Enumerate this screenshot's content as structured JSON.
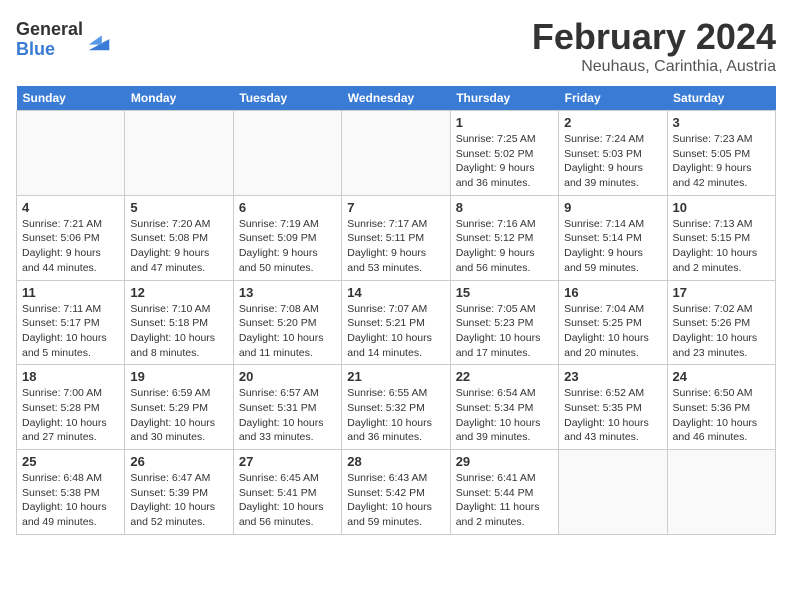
{
  "logo": {
    "general": "General",
    "blue": "Blue"
  },
  "title": {
    "month": "February 2024",
    "location": "Neuhaus, Carinthia, Austria"
  },
  "weekdays": [
    "Sunday",
    "Monday",
    "Tuesday",
    "Wednesday",
    "Thursday",
    "Friday",
    "Saturday"
  ],
  "weeks": [
    [
      {
        "day": "",
        "info": ""
      },
      {
        "day": "",
        "info": ""
      },
      {
        "day": "",
        "info": ""
      },
      {
        "day": "",
        "info": ""
      },
      {
        "day": "1",
        "info": "Sunrise: 7:25 AM\nSunset: 5:02 PM\nDaylight: 9 hours\nand 36 minutes."
      },
      {
        "day": "2",
        "info": "Sunrise: 7:24 AM\nSunset: 5:03 PM\nDaylight: 9 hours\nand 39 minutes."
      },
      {
        "day": "3",
        "info": "Sunrise: 7:23 AM\nSunset: 5:05 PM\nDaylight: 9 hours\nand 42 minutes."
      }
    ],
    [
      {
        "day": "4",
        "info": "Sunrise: 7:21 AM\nSunset: 5:06 PM\nDaylight: 9 hours\nand 44 minutes."
      },
      {
        "day": "5",
        "info": "Sunrise: 7:20 AM\nSunset: 5:08 PM\nDaylight: 9 hours\nand 47 minutes."
      },
      {
        "day": "6",
        "info": "Sunrise: 7:19 AM\nSunset: 5:09 PM\nDaylight: 9 hours\nand 50 minutes."
      },
      {
        "day": "7",
        "info": "Sunrise: 7:17 AM\nSunset: 5:11 PM\nDaylight: 9 hours\nand 53 minutes."
      },
      {
        "day": "8",
        "info": "Sunrise: 7:16 AM\nSunset: 5:12 PM\nDaylight: 9 hours\nand 56 minutes."
      },
      {
        "day": "9",
        "info": "Sunrise: 7:14 AM\nSunset: 5:14 PM\nDaylight: 9 hours\nand 59 minutes."
      },
      {
        "day": "10",
        "info": "Sunrise: 7:13 AM\nSunset: 5:15 PM\nDaylight: 10 hours\nand 2 minutes."
      }
    ],
    [
      {
        "day": "11",
        "info": "Sunrise: 7:11 AM\nSunset: 5:17 PM\nDaylight: 10 hours\nand 5 minutes."
      },
      {
        "day": "12",
        "info": "Sunrise: 7:10 AM\nSunset: 5:18 PM\nDaylight: 10 hours\nand 8 minutes."
      },
      {
        "day": "13",
        "info": "Sunrise: 7:08 AM\nSunset: 5:20 PM\nDaylight: 10 hours\nand 11 minutes."
      },
      {
        "day": "14",
        "info": "Sunrise: 7:07 AM\nSunset: 5:21 PM\nDaylight: 10 hours\nand 14 minutes."
      },
      {
        "day": "15",
        "info": "Sunrise: 7:05 AM\nSunset: 5:23 PM\nDaylight: 10 hours\nand 17 minutes."
      },
      {
        "day": "16",
        "info": "Sunrise: 7:04 AM\nSunset: 5:25 PM\nDaylight: 10 hours\nand 20 minutes."
      },
      {
        "day": "17",
        "info": "Sunrise: 7:02 AM\nSunset: 5:26 PM\nDaylight: 10 hours\nand 23 minutes."
      }
    ],
    [
      {
        "day": "18",
        "info": "Sunrise: 7:00 AM\nSunset: 5:28 PM\nDaylight: 10 hours\nand 27 minutes."
      },
      {
        "day": "19",
        "info": "Sunrise: 6:59 AM\nSunset: 5:29 PM\nDaylight: 10 hours\nand 30 minutes."
      },
      {
        "day": "20",
        "info": "Sunrise: 6:57 AM\nSunset: 5:31 PM\nDaylight: 10 hours\nand 33 minutes."
      },
      {
        "day": "21",
        "info": "Sunrise: 6:55 AM\nSunset: 5:32 PM\nDaylight: 10 hours\nand 36 minutes."
      },
      {
        "day": "22",
        "info": "Sunrise: 6:54 AM\nSunset: 5:34 PM\nDaylight: 10 hours\nand 39 minutes."
      },
      {
        "day": "23",
        "info": "Sunrise: 6:52 AM\nSunset: 5:35 PM\nDaylight: 10 hours\nand 43 minutes."
      },
      {
        "day": "24",
        "info": "Sunrise: 6:50 AM\nSunset: 5:36 PM\nDaylight: 10 hours\nand 46 minutes."
      }
    ],
    [
      {
        "day": "25",
        "info": "Sunrise: 6:48 AM\nSunset: 5:38 PM\nDaylight: 10 hours\nand 49 minutes."
      },
      {
        "day": "26",
        "info": "Sunrise: 6:47 AM\nSunset: 5:39 PM\nDaylight: 10 hours\nand 52 minutes."
      },
      {
        "day": "27",
        "info": "Sunrise: 6:45 AM\nSunset: 5:41 PM\nDaylight: 10 hours\nand 56 minutes."
      },
      {
        "day": "28",
        "info": "Sunrise: 6:43 AM\nSunset: 5:42 PM\nDaylight: 10 hours\nand 59 minutes."
      },
      {
        "day": "29",
        "info": "Sunrise: 6:41 AM\nSunset: 5:44 PM\nDaylight: 11 hours\nand 2 minutes."
      },
      {
        "day": "",
        "info": ""
      },
      {
        "day": "",
        "info": ""
      }
    ]
  ]
}
